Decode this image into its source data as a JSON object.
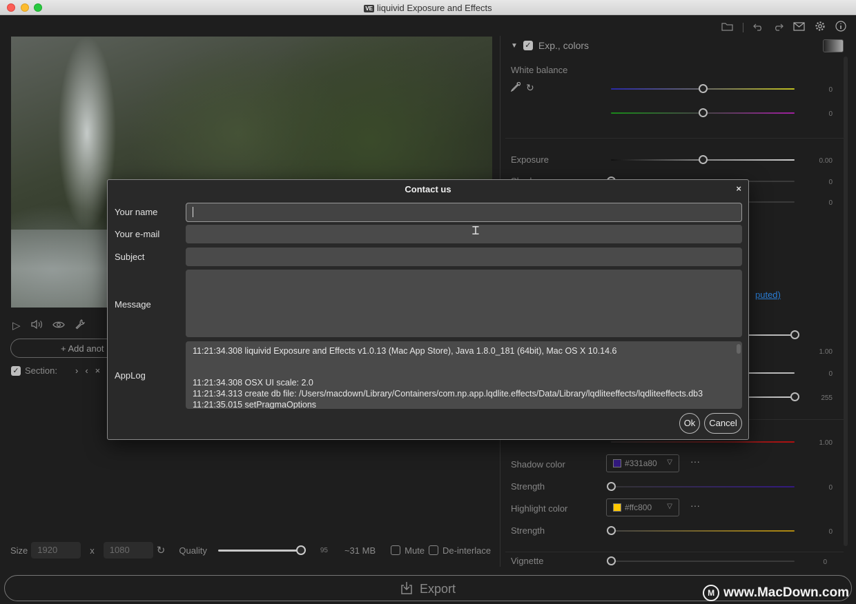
{
  "window": {
    "title": "liquivid Exposure and Effects",
    "badge": "VE"
  },
  "icons": {
    "folder": "folder-icon",
    "undo": "undo-icon",
    "redo": "redo-icon",
    "mail": "mail-icon",
    "settings": "gear-icon",
    "info": "info-icon"
  },
  "player": {
    "add_button_label": "+ Add anot",
    "section_label": "Section:"
  },
  "bottom_bar": {
    "size_label": "Size",
    "width": "1920",
    "x_sep": "x",
    "height": "1080",
    "quality_label": "Quality",
    "quality_value": "95",
    "quality_fraction": 0.95,
    "file_size": "~31 MB",
    "mute_label": "Mute",
    "deinterlace_label": "De-interlace",
    "export_label": "Export"
  },
  "watermark": {
    "text": "www.MacDown.com",
    "logo": "M"
  },
  "right_panel": {
    "section_title": "Exp., colors",
    "white_balance_label": "White balance",
    "wb_temp_value": "0",
    "wb_tint_value": "0",
    "exposure_label": "Exposure",
    "exposure_value": "0.00",
    "shadows_label": "Shadows",
    "shadows_value": "0",
    "row3_value": "0",
    "link_fragment": "puted)",
    "val_a": "1.00",
    "val_b": "0",
    "val_c": "255",
    "val_d": "1.00",
    "shadow_color_label": "Shadow color",
    "shadow_color_value": "#331a80",
    "shadow_strength_label": "Strength",
    "shadow_strength_value": "0",
    "highlight_color_label": "Highlight color",
    "highlight_color_value": "#ffc800",
    "highlight_strength_label": "Strength",
    "highlight_strength_value": "0",
    "vignette_label": "Vignette",
    "vignette_value": "0",
    "more_label": "···"
  },
  "dialog": {
    "title": "Contact us",
    "close": "×",
    "name_label": "Your name",
    "name_value": "",
    "email_label": "Your e-mail",
    "email_value": "",
    "subject_label": "Subject",
    "subject_value": "",
    "message_label": "Message",
    "message_value": "",
    "applog_label": "AppLog",
    "applog_lines": [
      "11:21:34.308 liquivid Exposure and Effects v1.0.13 (Mac App Store), Java 1.8.0_181 (64bit), Mac OS X 10.14.6",
      "11:21:34.308 OSX UI scale: 2.0",
      "11:21:34.313 create db file: /Users/macdown/Library/Containers/com.np.app.lqdlite.effects/Data/Library/lqdliteeffects/lqdliteeffects.db3",
      "11:21:35.015 setPragmaOptions"
    ],
    "ok_label": "Ok",
    "cancel_label": "Cancel"
  }
}
